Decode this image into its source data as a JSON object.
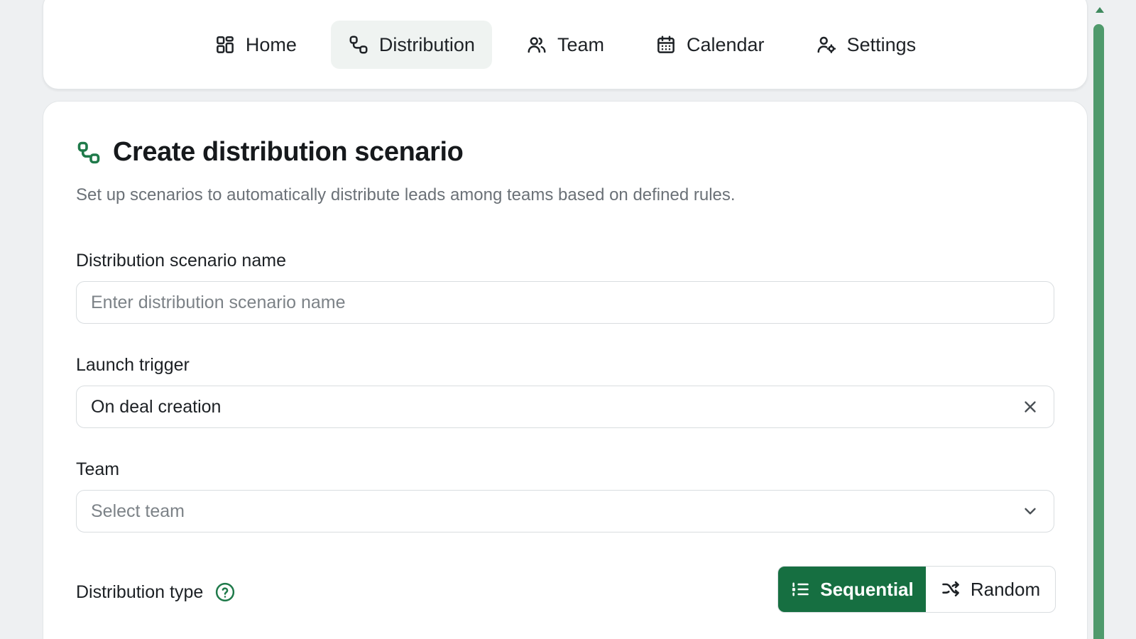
{
  "nav": {
    "items": [
      {
        "label": "Home",
        "icon": "grid-icon",
        "active": false
      },
      {
        "label": "Distribution",
        "icon": "route-icon",
        "active": true
      },
      {
        "label": "Team",
        "icon": "users-icon",
        "active": false
      },
      {
        "label": "Calendar",
        "icon": "calendar-icon",
        "active": false
      },
      {
        "label": "Settings",
        "icon": "user-settings-icon",
        "active": false
      }
    ]
  },
  "page": {
    "title": "Create distribution scenario",
    "title_icon": "route-icon",
    "subtitle": "Set up scenarios to automatically distribute leads among teams based on defined rules."
  },
  "form": {
    "name": {
      "label": "Distribution scenario name",
      "placeholder": "Enter distribution scenario name",
      "value": ""
    },
    "trigger": {
      "label": "Launch trigger",
      "value": "On deal creation",
      "clear_icon": "close-icon"
    },
    "team": {
      "label": "Team",
      "placeholder": "Select team",
      "icon": "chevron-down-icon"
    },
    "distribution_type": {
      "label": "Distribution type",
      "help_icon": "help-circle-icon",
      "options": [
        {
          "label": "Sequential",
          "icon": "list-ordered-icon",
          "selected": true
        },
        {
          "label": "Random",
          "icon": "shuffle-icon",
          "selected": false
        }
      ]
    }
  },
  "colors": {
    "accent": "#166f41",
    "active_nav_bg": "#eff3f1",
    "scrollbar": "#4f9a6c"
  }
}
